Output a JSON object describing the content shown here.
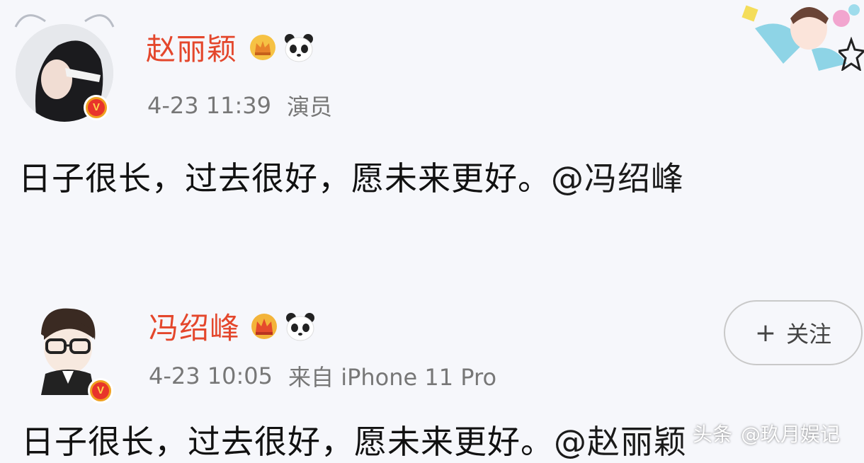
{
  "post1": {
    "username": "赵丽颖",
    "timestamp": "4-23 11:39",
    "meta": "演员",
    "content": "日子很长，过去很好，愿未来更好。",
    "mention": "@冯绍峰"
  },
  "post2": {
    "username": "冯绍峰",
    "timestamp": "4-23 10:05",
    "meta": "来自 iPhone 11 Pro",
    "content": "日子很长，过去很好，愿未来更好。",
    "mention": "@赵丽颖",
    "follow_plus": "+",
    "follow_label": "关注"
  },
  "watermark": {
    "platform": "头条",
    "handle": "@玖月娱记"
  },
  "colors": {
    "username": "#e4472c",
    "verified_badge": "#f0a020",
    "background": "#f6f7fb"
  },
  "icons": [
    "crown-icon",
    "panda-icon",
    "verified-icon",
    "star-icon",
    "plus-icon"
  ]
}
